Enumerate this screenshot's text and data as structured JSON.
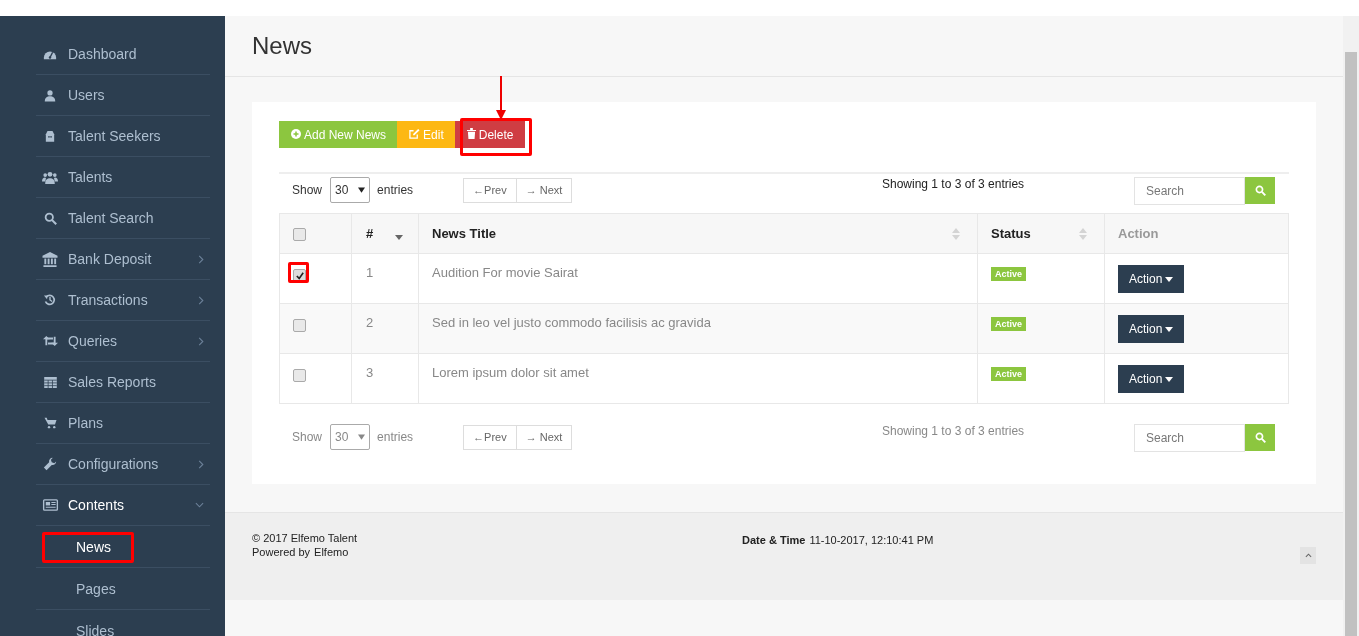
{
  "sidebar": {
    "items": [
      {
        "label": "Dashboard",
        "has_submenu": false
      },
      {
        "label": "Users",
        "has_submenu": false
      },
      {
        "label": "Talent Seekers",
        "has_submenu": false
      },
      {
        "label": "Talents",
        "has_submenu": false
      },
      {
        "label": "Talent Search",
        "has_submenu": false
      },
      {
        "label": "Bank Deposit",
        "has_submenu": true,
        "expanded": false
      },
      {
        "label": "Transactions",
        "has_submenu": true,
        "expanded": false
      },
      {
        "label": "Queries",
        "has_submenu": true,
        "expanded": false
      },
      {
        "label": "Sales Reports",
        "has_submenu": false
      },
      {
        "label": "Plans",
        "has_submenu": false
      },
      {
        "label": "Configurations",
        "has_submenu": true,
        "expanded": false
      },
      {
        "label": "Contents",
        "has_submenu": true,
        "expanded": true,
        "children": [
          {
            "label": "News",
            "selected": true,
            "highlighted": true
          },
          {
            "label": "Pages",
            "selected": false,
            "highlighted": false
          },
          {
            "label": "Slides",
            "selected": false,
            "highlighted": false
          }
        ]
      }
    ]
  },
  "page": {
    "title": "News"
  },
  "toolbar": {
    "buttons": [
      {
        "kind": "add",
        "label": "Add New News",
        "highlighted": false
      },
      {
        "kind": "edit",
        "label": "Edit",
        "highlighted": false
      },
      {
        "kind": "delete",
        "label": "Delete",
        "highlighted": true
      }
    ]
  },
  "controls": [
    {
      "muted": false,
      "show_label": "Show",
      "page_size": "30",
      "entries_label": "entries",
      "prev": "←Prev",
      "next": "→ Next",
      "info": "Showing 1 to 3 of 3 entries",
      "search_placeholder": "Search"
    },
    {
      "muted": true,
      "show_label": "Show",
      "page_size": "30",
      "entries_label": "entries",
      "prev": "←Prev",
      "next": "→ Next",
      "info": "Showing 1 to 3 of 3 entries",
      "search_placeholder": "Search"
    }
  ],
  "table": {
    "columns": [
      {
        "kind": "checkbox",
        "checked": false
      },
      {
        "kind": "sorted",
        "label": "#"
      },
      {
        "kind": "sortable",
        "label": "News Title"
      },
      {
        "kind": "sortable",
        "label": "Status"
      },
      {
        "kind": "plain",
        "label": "Action"
      }
    ],
    "rows": [
      {
        "checked": true,
        "highlighted": true,
        "number": "1",
        "title": "Audition For movie Sairat",
        "status": "Active",
        "action": "Action"
      },
      {
        "checked": false,
        "highlighted": false,
        "number": "2",
        "title": "Sed in leo vel justo commodo facilisis ac gravida",
        "status": "Active",
        "action": "Action"
      },
      {
        "checked": false,
        "highlighted": false,
        "number": "3",
        "title": "Lorem ipsum dolor sit amet",
        "status": "Active",
        "action": "Action"
      }
    ]
  },
  "footer": {
    "copyright": "© 2017 Elfemo Talent",
    "powered_by": "Powered by",
    "powered_link": "Elfemo",
    "datetime_label": "Date & Time",
    "datetime_value": "11-10-2017, 12:10:41 PM"
  }
}
